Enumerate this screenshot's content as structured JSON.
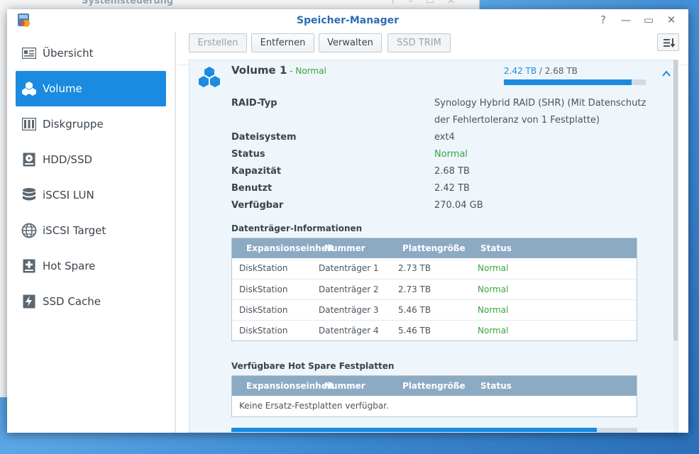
{
  "background_window": {
    "title": "Systemsteuerung"
  },
  "window": {
    "title": "Speicher-Manager",
    "controls": {
      "help": "?",
      "minimize": "—",
      "maximize": "▭",
      "close": "✕"
    }
  },
  "sidebar": {
    "items": [
      {
        "label": "Übersicht",
        "icon": "overview-icon"
      },
      {
        "label": "Volume",
        "icon": "volume-icon",
        "active": true
      },
      {
        "label": "Diskgruppe",
        "icon": "diskgroup-icon"
      },
      {
        "label": "HDD/SSD",
        "icon": "hdd-icon"
      },
      {
        "label": "iSCSI LUN",
        "icon": "database-icon"
      },
      {
        "label": "iSCSI Target",
        "icon": "globe-icon"
      },
      {
        "label": "Hot Spare",
        "icon": "hot-spare-icon"
      },
      {
        "label": "SSD Cache",
        "icon": "ssd-cache-icon"
      }
    ]
  },
  "toolbar": {
    "create": "Erstellen",
    "remove": "Entfernen",
    "manage": "Verwalten",
    "trim": "SSD TRIM"
  },
  "volume": {
    "name": "Volume 1",
    "status_sep": " - ",
    "status": "Normal",
    "used": "2.42 TB",
    "slash": " / ",
    "total": "2.68 TB",
    "usage_fraction": 0.9
  },
  "properties": [
    {
      "key": "RAID-Typ",
      "value": "Synology Hybrid RAID (SHR) (Mit Datenschutz der Fehlertoleranz von 1 Festplatte)"
    },
    {
      "key": "Dateisystem",
      "value": "ext4"
    },
    {
      "key": "Status",
      "value": "Normal"
    },
    {
      "key": "Kapazität",
      "value": "2.68 TB"
    },
    {
      "key": "Benutzt",
      "value": "2.42 TB"
    },
    {
      "key": "Verfügbar",
      "value": "270.04 GB"
    }
  ],
  "disk_info": {
    "title": "Datenträger-Informationen",
    "headers": [
      "Expansionseinheit",
      "Nummer",
      "Plattengröße",
      "Status"
    ],
    "rows": [
      [
        "DiskStation",
        "Datenträger 1",
        "2.73 TB",
        "Normal"
      ],
      [
        "DiskStation",
        "Datenträger 2",
        "2.73 TB",
        "Normal"
      ],
      [
        "DiskStation",
        "Datenträger 3",
        "5.46 TB",
        "Normal"
      ],
      [
        "DiskStation",
        "Datenträger 4",
        "5.46 TB",
        "Normal"
      ]
    ]
  },
  "hot_spare": {
    "title": "Verfügbare Hot Spare Festplatten",
    "headers": [
      "Expansionseinheit",
      "Nummer",
      "Plattengröße",
      "Status"
    ],
    "empty": "Keine Ersatz-Festplatten verfügbar."
  },
  "colors": {
    "accent": "#1a8be0",
    "ok": "#3da33d",
    "table_header": "#8daac3"
  }
}
